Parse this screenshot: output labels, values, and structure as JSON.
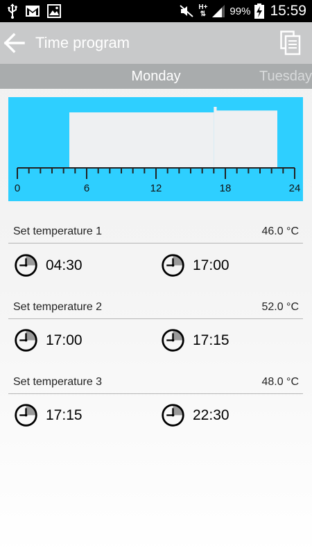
{
  "status_bar": {
    "icons_left": [
      "usb-icon",
      "mail-icon",
      "image-icon"
    ],
    "network_type": "H+",
    "battery_percent": "99%",
    "time": "15:59"
  },
  "action_bar": {
    "title": "Time program",
    "back_icon": "arrow-left-icon",
    "action_icon": "copy-icon"
  },
  "day_tabs": {
    "current": "Monday",
    "next": "Tuesday"
  },
  "chart_data": {
    "type": "area",
    "x_ticks": [
      "0",
      "6",
      "12",
      "18",
      "24"
    ],
    "xlim": [
      0,
      24
    ],
    "segments": [
      {
        "start": 4.5,
        "end": 17.0,
        "temperature": 46.0
      },
      {
        "start": 17.0,
        "end": 17.25,
        "temperature": 52.0
      },
      {
        "start": 17.25,
        "end": 22.5,
        "temperature": 48.0
      }
    ],
    "background_color": "#2ecfff",
    "fill_color": "#eef0f2"
  },
  "programs": [
    {
      "label": "Set temperature 1",
      "temperature": "46.0 °C",
      "start": "04:30",
      "end": "17:00"
    },
    {
      "label": "Set temperature 2",
      "temperature": "52.0 °C",
      "start": "17:00",
      "end": "17:15"
    },
    {
      "label": "Set temperature 3",
      "temperature": "48.0 °C",
      "start": "17:15",
      "end": "22:30"
    }
  ]
}
